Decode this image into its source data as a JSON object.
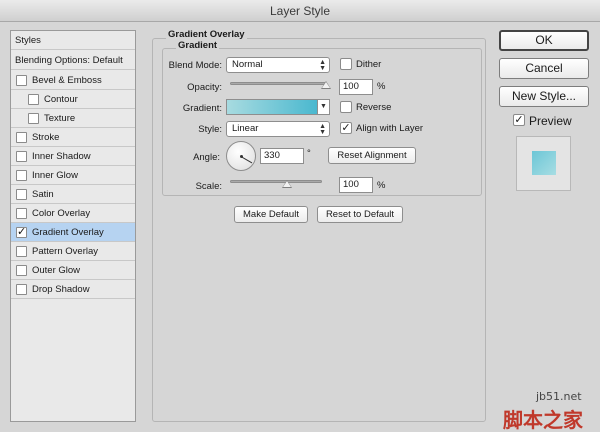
{
  "window": {
    "title": "Layer Style"
  },
  "styles_list": {
    "header": "Styles",
    "blending": "Blending Options: Default",
    "items": [
      {
        "label": "Bevel & Emboss",
        "checked": false,
        "indent": 0
      },
      {
        "label": "Contour",
        "checked": false,
        "indent": 1
      },
      {
        "label": "Texture",
        "checked": false,
        "indent": 1
      },
      {
        "label": "Stroke",
        "checked": false,
        "indent": 0
      },
      {
        "label": "Inner Shadow",
        "checked": false,
        "indent": 0
      },
      {
        "label": "Inner Glow",
        "checked": false,
        "indent": 0
      },
      {
        "label": "Satin",
        "checked": false,
        "indent": 0
      },
      {
        "label": "Color Overlay",
        "checked": false,
        "indent": 0
      },
      {
        "label": "Gradient Overlay",
        "checked": true,
        "indent": 0,
        "selected": true
      },
      {
        "label": "Pattern Overlay",
        "checked": false,
        "indent": 0
      },
      {
        "label": "Outer Glow",
        "checked": false,
        "indent": 0
      },
      {
        "label": "Drop Shadow",
        "checked": false,
        "indent": 0
      }
    ]
  },
  "panel": {
    "title": "Gradient Overlay",
    "subtitle": "Gradient",
    "blend_mode": {
      "label": "Blend Mode:",
      "value": "Normal"
    },
    "dither": {
      "label": "Dither",
      "checked": false
    },
    "opacity": {
      "label": "Opacity:",
      "value": "100",
      "unit": "%",
      "fraction": 1.0
    },
    "gradient": {
      "label": "Gradient:",
      "start_color": "#a8dbe0",
      "end_color": "#4ab8cf"
    },
    "reverse": {
      "label": "Reverse",
      "checked": false
    },
    "style": {
      "label": "Style:",
      "value": "Linear"
    },
    "align_with_layer": {
      "label": "Align with Layer",
      "checked": true
    },
    "angle": {
      "label": "Angle:",
      "value": "330",
      "unit": "°"
    },
    "reset_alignment": "Reset Alignment",
    "scale": {
      "label": "Scale:",
      "value": "100",
      "unit": "%",
      "fraction": 0.62
    },
    "make_default": "Make Default",
    "reset_to_default": "Reset to Default"
  },
  "buttons": {
    "ok": "OK",
    "cancel": "Cancel",
    "new_style": "New Style...",
    "preview": {
      "label": "Preview",
      "checked": true
    }
  },
  "watermark": {
    "site": "jb51.net",
    "cn": "脚本之家"
  },
  "colors": {
    "selected_row": "#b6d3f1",
    "preview_swatch": "#6cc6d6"
  }
}
